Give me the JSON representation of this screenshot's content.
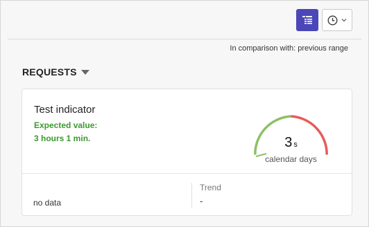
{
  "toolbar": {
    "list_view_icon": "list-tree-icon",
    "clock_icon": "clock-icon",
    "chevron_icon": "chevron-down-icon",
    "active_color": "#4b47b8"
  },
  "comparison_text": "In comparison with: previous range",
  "section": {
    "title": "REQUESTS",
    "caret_icon": "caret-down-icon"
  },
  "card": {
    "title": "Test indicator",
    "expected_label": "Expected value:",
    "expected_value": "3 hours 1 min.",
    "expected_color": "#3a9a2e",
    "gauge": {
      "value": "3",
      "unit": "s",
      "caption": "calendar days",
      "green_color": "#8cc063",
      "red_color": "#e85a5a"
    },
    "footer": {
      "left_text": "no data",
      "trend_label": "Trend",
      "trend_value": "-"
    }
  }
}
